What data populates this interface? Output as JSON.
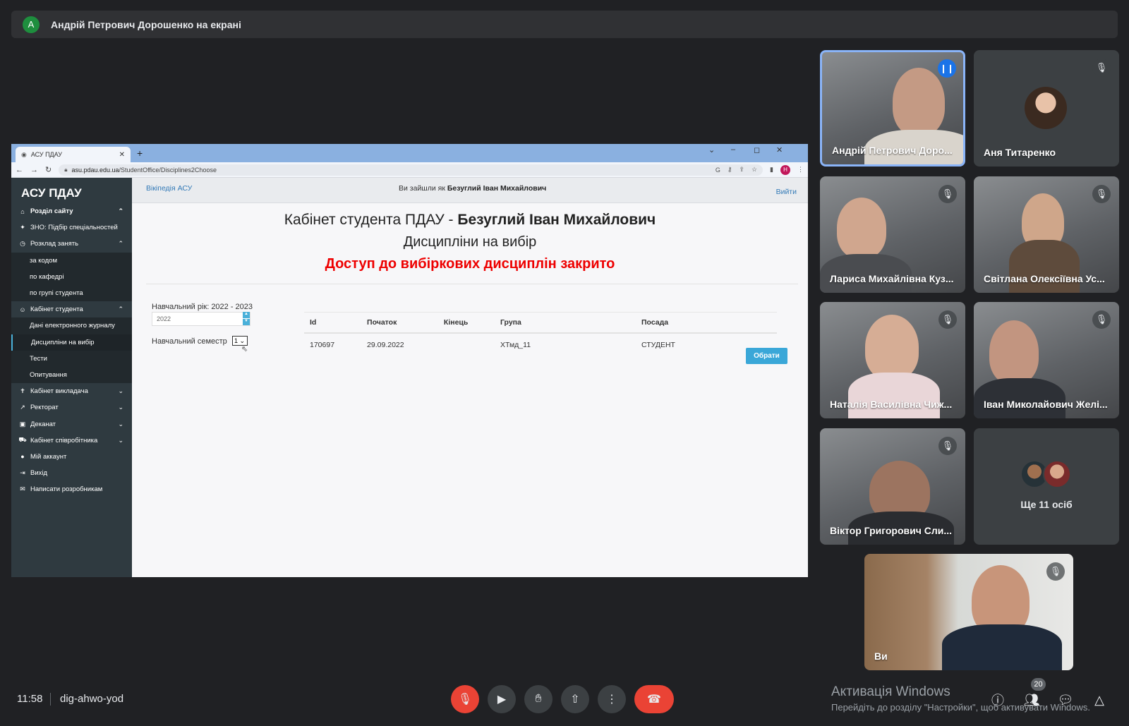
{
  "banner": {
    "avatar_letter": "A",
    "text": "Андрій Петрович Дорошенко на екрані"
  },
  "browser": {
    "tab_title": "АСУ ПДАУ",
    "url_host": "asu.pdau.edu.ua",
    "url_path": "/StudentOffice/Disciplines2Choose",
    "profile_letter": "Н"
  },
  "site": {
    "logo": "АСУ ПДАУ",
    "sidebar": [
      {
        "label": "Розділ сайту",
        "icon": "bank-icon",
        "chev": "^",
        "bold": true
      },
      {
        "label": "ЗНО: Підбір спеціальностей",
        "icon": "puzzle-icon"
      },
      {
        "label": "Розклад занять",
        "icon": "clock-icon",
        "chev": "^"
      },
      {
        "label": "за кодом",
        "sub": true
      },
      {
        "label": "по кафедрі",
        "sub": true
      },
      {
        "label": "по групі студента",
        "sub": true
      },
      {
        "label": "Кабінет студента",
        "icon": "smile-icon",
        "chev": "^"
      },
      {
        "label": "Дані електронного журналу",
        "sub": true
      },
      {
        "label": "Дисципліни на вибір",
        "sub": true,
        "active": true
      },
      {
        "label": "Тести",
        "sub": true
      },
      {
        "label": "Опитування",
        "sub": true
      },
      {
        "label": "Кабінет викладача",
        "icon": "person-icon",
        "chev": "v"
      },
      {
        "label": "Ректорат",
        "icon": "chart-icon",
        "chev": "v"
      },
      {
        "label": "Деканат",
        "icon": "id-card-icon",
        "chev": "v"
      },
      {
        "label": "Кабінет співробітника",
        "icon": "car-icon",
        "chev": "v"
      },
      {
        "label": "Мій аккаунт",
        "icon": "user-circle-icon"
      },
      {
        "label": "Вихід",
        "icon": "exit-icon"
      },
      {
        "label": "Написати розробникам",
        "icon": "mail-icon"
      }
    ],
    "topbar": {
      "wiki": "Вікіпедія АСУ",
      "who_prefix": "Ви зайшли як",
      "who_name": "Безуглий Іван Михайлович",
      "exit": "Вийти"
    },
    "heading_prefix": "Кабінет студента ПДАУ -",
    "heading_name": "Безуглий Іван Михайлович",
    "subheading": "Дисципліни на вибір",
    "closed_notice": "Доступ до вибіркових дисциплін закрито",
    "year_label": "Навчальний рік: 2022 - 2023",
    "year_value": "2022",
    "semester_label": "Навчальний семестр",
    "semester_value": "1",
    "table": {
      "headers": [
        "Id",
        "Початок",
        "Кінець",
        "Група",
        "Посада"
      ],
      "rows": [
        [
          "170697",
          "29.09.2022",
          "",
          "ХТмд_11",
          "СТУДЕНТ"
        ]
      ]
    },
    "choose_button": "Обрати"
  },
  "participants": [
    {
      "name": "Андрій Петрович Доро...",
      "speaking": true
    },
    {
      "name": "Аня Титаренко"
    },
    {
      "name": "Лариса Михайлівна Куз..."
    },
    {
      "name": "Світлана Олексіївна Ус..."
    },
    {
      "name": "Наталія Василівна Чиж..."
    },
    {
      "name": "Іван Миколайович Желі..."
    },
    {
      "name": "Віктор Григорович Сли..."
    },
    {
      "name": "Ще 11 осіб"
    },
    {
      "name": "Ви"
    }
  ],
  "bottom": {
    "time": "11:58",
    "meeting_code": "dig-ahwo-yod",
    "people_count": "20",
    "activation_title": "Активація Windows",
    "activation_sub": "Перейдіть до розділу \"Настройки\", щоб активувати Windows."
  }
}
